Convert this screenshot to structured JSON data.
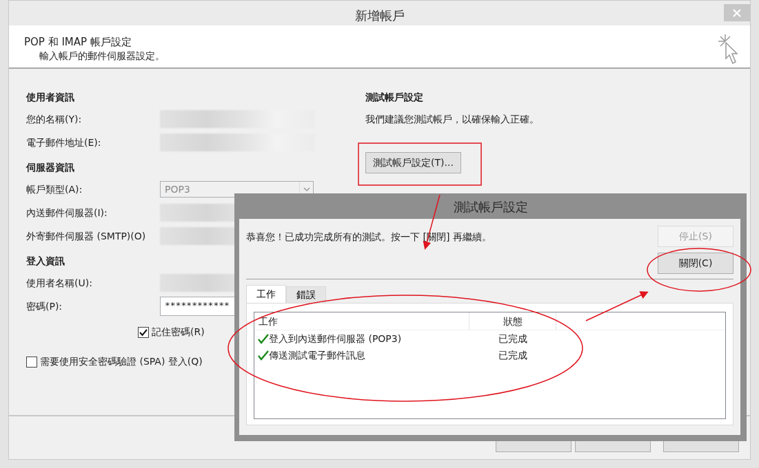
{
  "window": {
    "title": "新增帳戶"
  },
  "header": {
    "title": "POP 和 IMAP 帳戶設定",
    "subtitle": "輸入帳戶的郵件伺服器設定。"
  },
  "groups": [
    {
      "heading": "使用者資訊",
      "rows": [
        {
          "label": "您的名稱(Y):",
          "kind": "blurred"
        },
        {
          "label": "電子郵件地址(E):",
          "kind": "blurred"
        }
      ]
    },
    {
      "heading": "伺服器資訊",
      "rows": [
        {
          "label": "帳戶類型(A):",
          "kind": "select",
          "value": "POP3",
          "disabled": true
        },
        {
          "label": "內送郵件伺服器(I):",
          "kind": "blurred"
        },
        {
          "label": "外寄郵件伺服器 (SMTP)(O)",
          "kind": "blurred"
        }
      ]
    },
    {
      "heading": "登入資訊",
      "rows": [
        {
          "label": "使用者名稱(U):",
          "kind": "blurred"
        },
        {
          "label": "密碼(P):",
          "kind": "password",
          "value": "************"
        }
      ]
    }
  ],
  "remember_password": {
    "label": "記住密碼(R)",
    "checked": true
  },
  "spa": {
    "label": "需要使用安全密碼驗證 (SPA) 登入(Q)",
    "checked": false
  },
  "test": {
    "heading": "測試帳戶設定",
    "text": "我們建議您測試帳戶，以確保輸入正確。",
    "button": "測試帳戶設定(T)..."
  },
  "test_dialog": {
    "title": "測試帳戶設定",
    "message": "恭喜您！已成功完成所有的測試。按一下 [關閉] 再繼續。",
    "buttons": [
      {
        "label": "停止(S)",
        "disabled": true
      },
      {
        "label": "關閉(C)",
        "disabled": false
      }
    ],
    "tabs": [
      {
        "label": "工作",
        "selected": true
      },
      {
        "label": "錯誤",
        "selected": false
      }
    ],
    "columns": [
      "工作",
      "狀態"
    ],
    "tasks": [
      {
        "name": "登入到內送郵件伺服器 (POP3)",
        "status": "已完成",
        "done": true
      },
      {
        "name": "傳送測試電子郵件訊息",
        "status": "已完成",
        "done": true
      }
    ]
  }
}
